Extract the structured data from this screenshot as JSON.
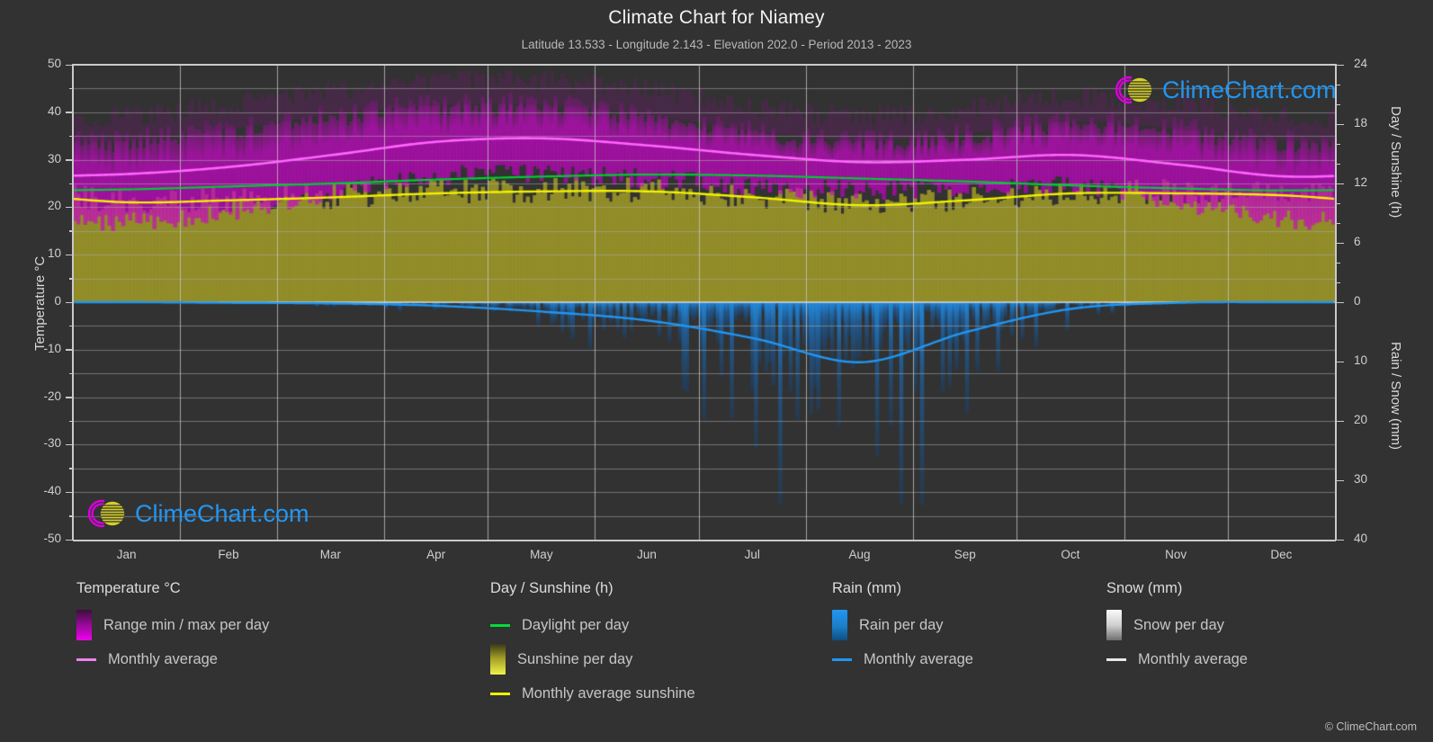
{
  "header": {
    "title": "Climate Chart for Niamey",
    "subtitle": "Latitude 13.533 - Longitude 2.143 - Elevation 202.0 - Period 2013 - 2023"
  },
  "axes": {
    "left_title": "Temperature °C",
    "right_top_title": "Day / Sunshine (h)",
    "right_bottom_title": "Rain / Snow (mm)",
    "temp_ticks": [
      "50",
      "40",
      "30",
      "20",
      "10",
      "0",
      "-10",
      "-20",
      "-30",
      "-40",
      "-50"
    ],
    "day_ticks": [
      "24",
      "18",
      "12",
      "6",
      "0"
    ],
    "rain_ticks": [
      "0",
      "10",
      "20",
      "30",
      "40"
    ],
    "months": [
      "Jan",
      "Feb",
      "Mar",
      "Apr",
      "May",
      "Jun",
      "Jul",
      "Aug",
      "Sep",
      "Oct",
      "Nov",
      "Dec"
    ]
  },
  "legend": {
    "temperature": {
      "heading": "Temperature °C",
      "range_label": "Range min / max per day",
      "average_label": "Monthly average"
    },
    "sunshine": {
      "heading": "Day / Sunshine (h)",
      "daylight_label": "Daylight per day",
      "sunshine_label": "Sunshine per day",
      "average_label": "Monthly average sunshine"
    },
    "rain": {
      "heading": "Rain (mm)",
      "per_day_label": "Rain per day",
      "average_label": "Monthly average"
    },
    "snow": {
      "heading": "Snow (mm)",
      "per_day_label": "Snow per day",
      "average_label": "Monthly average"
    }
  },
  "watermark": {
    "text": "ClimeChart.com",
    "copyright": "© ClimeChart.com"
  },
  "colors": {
    "background": "#323232",
    "grid": "#8c8c8c",
    "axis": "#c9c9c9",
    "temp_range": "#cc00cc",
    "temp_range_dark": "#4a2a4a",
    "temp_average": "#ff66ff",
    "daylight": "#00cc33",
    "sunshine_band": "#9a9a28",
    "sunshine_average": "#f2f200",
    "rain": "#1a7ec8",
    "rain_average": "#2196f3",
    "snow": "#e8e8e8",
    "brand_blue": "#2196f3",
    "brand_magenta": "#d800d8",
    "brand_yellow": "#d4cf2a"
  },
  "chart_data": {
    "type": "area",
    "title": "Climate Chart for Niamey",
    "subtitle": "Latitude 13.533 - Longitude 2.143 - Elevation 202.0 - Period 2013 - 2023",
    "xlabel": "",
    "ylabel": "Temperature °C",
    "ylim": [
      -50,
      50
    ],
    "y2lim_day": [
      0,
      24
    ],
    "y2lim_rain": [
      0,
      40
    ],
    "grid": true,
    "legend_position": "below",
    "categories": [
      "Jan",
      "Feb",
      "Mar",
      "Apr",
      "May",
      "Jun",
      "Jul",
      "Aug",
      "Sep",
      "Oct",
      "Nov",
      "Dec"
    ],
    "series": [
      {
        "name": "Monthly average temperature",
        "unit": "°C",
        "color": "#ff66ff",
        "values": [
          27.0,
          28.5,
          31.0,
          33.8,
          34.5,
          33.0,
          31.0,
          29.5,
          30.0,
          31.0,
          29.0,
          26.5
        ]
      },
      {
        "name": "Daily max temperature (range top)",
        "unit": "°C",
        "color": "#cc00cc",
        "values": [
          34.0,
          36.5,
          39.5,
          41.5,
          41.5,
          39.5,
          36.0,
          34.0,
          35.5,
          38.0,
          36.5,
          34.0
        ]
      },
      {
        "name": "Daily min temperature (range bottom)",
        "unit": "°C",
        "color": "#cc00cc",
        "values": [
          17.0,
          19.0,
          23.0,
          26.5,
          27.0,
          26.0,
          24.5,
          23.5,
          24.0,
          24.5,
          21.0,
          17.5
        ]
      },
      {
        "name": "Daylight per day",
        "unit": "h",
        "color": "#00cc33",
        "values": [
          11.4,
          11.7,
          12.0,
          12.4,
          12.7,
          12.9,
          12.8,
          12.5,
          12.2,
          11.8,
          11.5,
          11.3
        ]
      },
      {
        "name": "Monthly average sunshine",
        "unit": "h",
        "color": "#f2f200",
        "values": [
          10.1,
          10.3,
          10.6,
          11.0,
          11.2,
          11.2,
          10.6,
          9.8,
          10.3,
          11.0,
          11.0,
          10.8
        ]
      },
      {
        "name": "Rain monthly average",
        "unit": "mm",
        "color": "#2196f3",
        "values": [
          0.0,
          0.1,
          0.2,
          0.6,
          1.6,
          3.1,
          6.1,
          10.1,
          5.0,
          1.1,
          0.1,
          0.0
        ]
      },
      {
        "name": "Snow monthly average",
        "unit": "mm",
        "color": "#e8e8e8",
        "values": [
          0,
          0,
          0,
          0,
          0,
          0,
          0,
          0,
          0,
          0,
          0,
          0
        ]
      }
    ]
  }
}
